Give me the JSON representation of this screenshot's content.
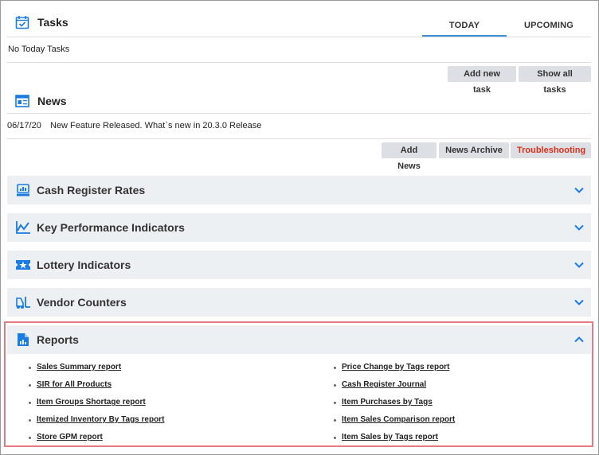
{
  "tasks": {
    "title": "Tasks",
    "tabs": [
      "TODAY",
      "UPCOMING"
    ],
    "active_tab": "TODAY",
    "empty_text": "No Today Tasks",
    "buttons": {
      "add": "Add new task",
      "show_all": "Show all tasks"
    }
  },
  "news": {
    "title": "News",
    "items": [
      {
        "date": "06/17/20",
        "text": "New Feature Released. What`s new in 20.3.0 Release"
      }
    ],
    "buttons": {
      "add": "Add News",
      "archive": "News Archive",
      "troubleshooting": "Troubleshooting"
    }
  },
  "accordions": [
    {
      "title": "Cash Register Rates",
      "icon": "cash-register-icon",
      "expanded": false
    },
    {
      "title": "Key Performance Indicators",
      "icon": "line-chart-icon",
      "expanded": false
    },
    {
      "title": "Lottery Indicators",
      "icon": "lottery-ticket-icon",
      "expanded": false
    },
    {
      "title": "Vendor Counters",
      "icon": "forklift-icon",
      "expanded": false
    },
    {
      "title": "Reports",
      "icon": "report-document-icon",
      "expanded": true
    }
  ],
  "reports": {
    "left": [
      "Sales Summary report",
      "SIR for All Products",
      "Item Groups Shortage report",
      "Itemized Inventory By Tags report",
      "Store GPM report"
    ],
    "right": [
      "Price Change by Tags report",
      "Cash Register Journal",
      "Item Purchases by Tags",
      "Item Sales Comparison report",
      "Item Sales by Tags report"
    ]
  },
  "colors": {
    "accent": "#1a7be0",
    "panel": "#edf0f3",
    "button": "#dcdfe3",
    "highlight_border": "#e57a82",
    "danger_text": "#d9301b"
  }
}
